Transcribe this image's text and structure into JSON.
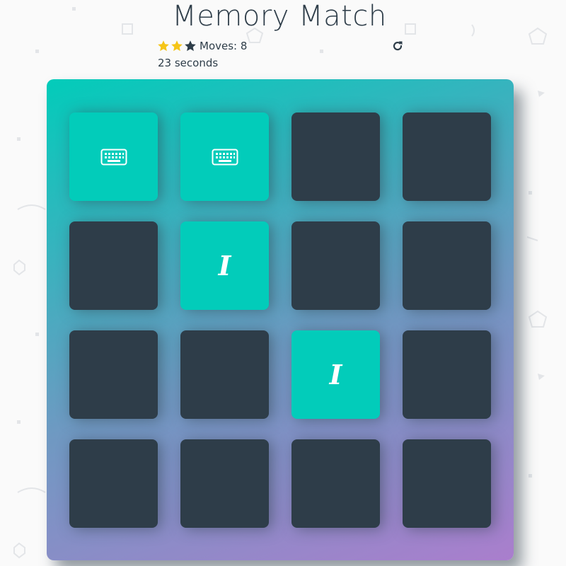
{
  "title": "Memory Match",
  "score_panel": {
    "stars_total": 3,
    "stars_filled": 2,
    "star_filled_color": "#f5c518",
    "star_empty_color": "#2e3d49",
    "moves_label": "Moves: 8",
    "timer_label": "23 seconds",
    "restart_icon": "redo-icon"
  },
  "colors": {
    "card_closed": "#2e3d49",
    "card_open": "#02ccba",
    "deck_gradient_start": "#02ccba",
    "deck_gradient_end": "#aa7ecd"
  },
  "deck": {
    "rows": 4,
    "cols": 4,
    "cards": [
      {
        "state": "open",
        "icon": "keyboard-icon",
        "symbol": ""
      },
      {
        "state": "open",
        "icon": "keyboard-icon",
        "symbol": ""
      },
      {
        "state": "closed",
        "icon": "",
        "symbol": ""
      },
      {
        "state": "closed",
        "icon": "",
        "symbol": ""
      },
      {
        "state": "closed",
        "icon": "",
        "symbol": ""
      },
      {
        "state": "open",
        "icon": "italic-icon",
        "symbol": "I"
      },
      {
        "state": "closed",
        "icon": "",
        "symbol": ""
      },
      {
        "state": "closed",
        "icon": "",
        "symbol": ""
      },
      {
        "state": "closed",
        "icon": "",
        "symbol": ""
      },
      {
        "state": "closed",
        "icon": "",
        "symbol": ""
      },
      {
        "state": "open",
        "icon": "italic-icon",
        "symbol": "I"
      },
      {
        "state": "closed",
        "icon": "",
        "symbol": ""
      },
      {
        "state": "closed",
        "icon": "",
        "symbol": ""
      },
      {
        "state": "closed",
        "icon": "",
        "symbol": ""
      },
      {
        "state": "closed",
        "icon": "",
        "symbol": ""
      },
      {
        "state": "closed",
        "icon": "",
        "symbol": ""
      }
    ]
  }
}
